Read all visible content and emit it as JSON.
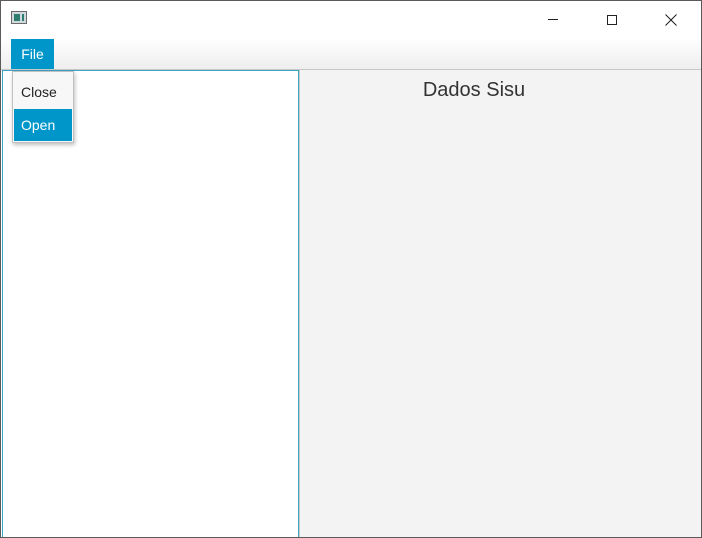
{
  "window": {
    "title": "",
    "controls": {
      "minimize": "minimize-icon",
      "maximize": "maximize-icon",
      "close": "close-icon"
    }
  },
  "menubar": {
    "file_label": "File"
  },
  "file_menu": {
    "items": [
      {
        "label": "Close",
        "highlighted": false
      },
      {
        "label": "Open",
        "highlighted": true
      }
    ]
  },
  "right_panel": {
    "title": "Dados Sisu"
  },
  "colors": {
    "accent": "#0096c9",
    "pane_border": "#3fa3c5",
    "right_background": "#f3f3f3"
  }
}
